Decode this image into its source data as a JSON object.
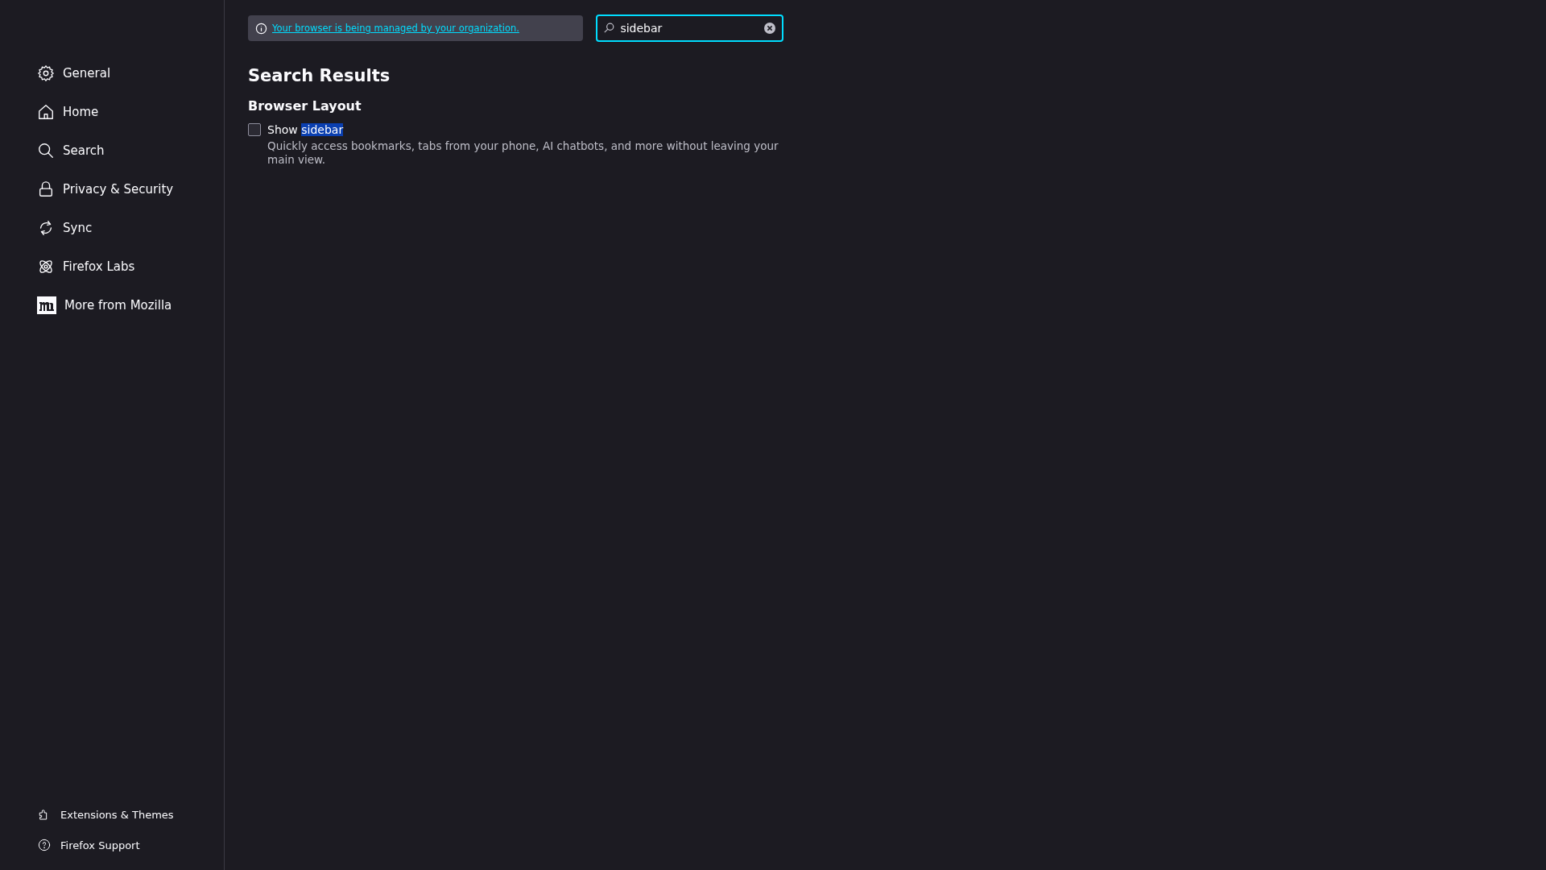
{
  "sidebar": {
    "items": [
      {
        "kind": "gear",
        "label": "General",
        "selected": false
      },
      {
        "kind": "home",
        "label": "Home",
        "selected": false
      },
      {
        "kind": "search",
        "label": "Search",
        "selected": false
      },
      {
        "kind": "lock",
        "label": "Privacy & Security",
        "selected": false
      },
      {
        "kind": "sync",
        "label": "Sync",
        "selected": false
      },
      {
        "kind": "atom",
        "label": "Firefox Labs",
        "selected": false
      },
      {
        "kind": "mozilla",
        "label": "More from Mozilla",
        "selected": false
      }
    ],
    "footer": [
      {
        "kind": "puzzle",
        "label": "Extensions & Themes"
      },
      {
        "kind": "help",
        "label": "Firefox Support"
      }
    ]
  },
  "notice": {
    "link": "Your browser is being managed by your organization."
  },
  "search": {
    "value": "sidebar"
  },
  "results": {
    "title": "Search Results",
    "groups": [
      {
        "title": "Browser Layout",
        "options": [
          {
            "label": "Show",
            "highlight": "sidebar",
            "checked": false,
            "description": "Quickly access bookmarks, tabs from your phone, AI chatbots, and more without leaving your main view."
          }
        ]
      }
    ]
  }
}
